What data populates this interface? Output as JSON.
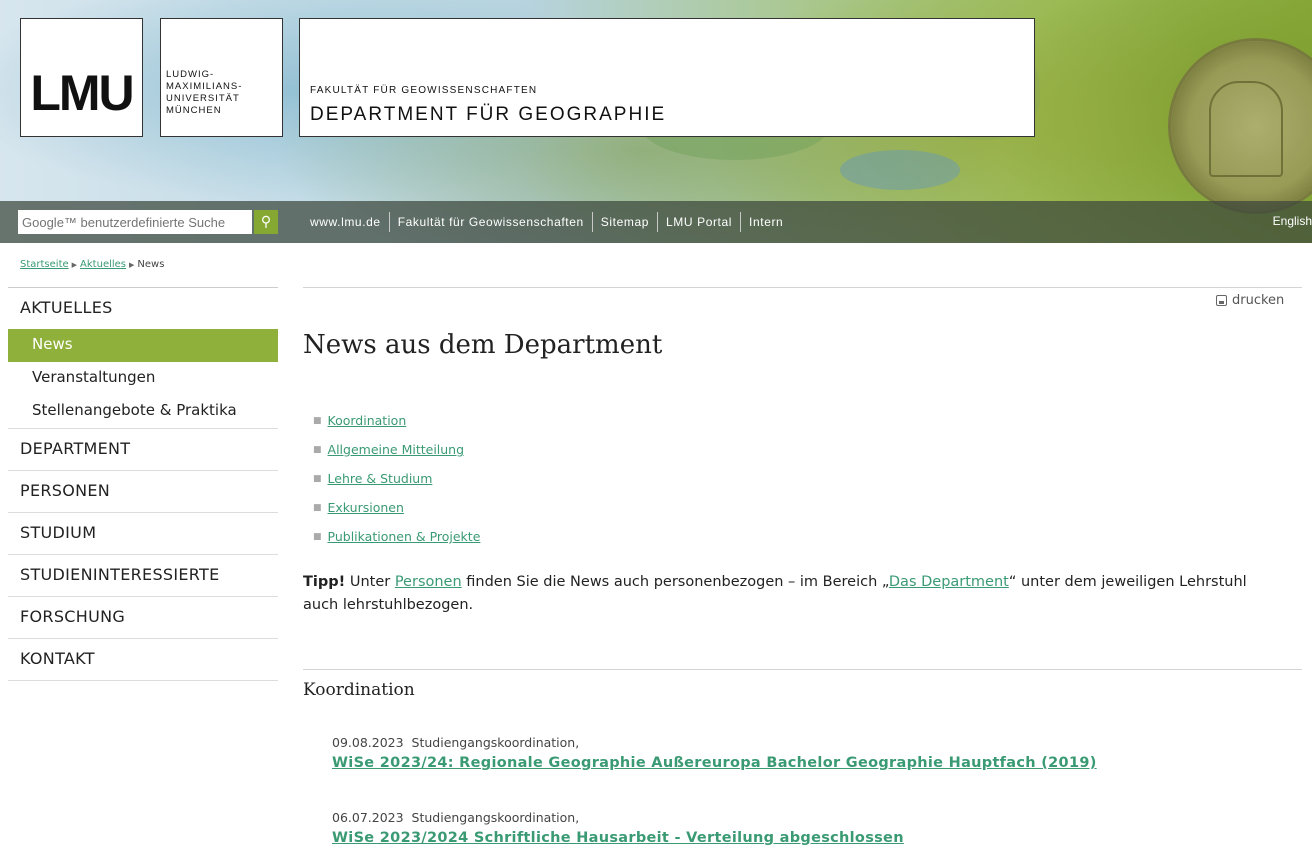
{
  "header": {
    "logo_text": "LMU",
    "university_lines": [
      "LUDWIG-",
      "MAXIMILIANS-",
      "UNIVERSITÄT",
      "MÜNCHEN"
    ],
    "faculty": "FAKULTÄT FÜR GEOWISSENSCHAFTEN",
    "department": "DEPARTMENT FÜR GEOGRAPHIE"
  },
  "search": {
    "placeholder": "Google™ benutzerdefinierte Suche",
    "icon": "search-icon"
  },
  "topnav": {
    "links": [
      "www.lmu.de",
      "Fakultät für Geowissenschaften",
      "Sitemap",
      "LMU Portal",
      "Intern"
    ],
    "language": "English"
  },
  "breadcrumb": [
    "Startseite",
    "Aktuelles",
    "News"
  ],
  "sidebar": {
    "sections": [
      {
        "label": "AKTUELLES",
        "items": [
          {
            "label": "News",
            "active": true
          },
          {
            "label": "Veranstaltungen"
          },
          {
            "label": "Stellenangebote & Praktika"
          }
        ]
      },
      {
        "label": "DEPARTMENT"
      },
      {
        "label": "PERSONEN"
      },
      {
        "label": "STUDIUM"
      },
      {
        "label": "STUDIENINTERESSIERTE"
      },
      {
        "label": "FORSCHUNG"
      },
      {
        "label": "KONTAKT"
      }
    ]
  },
  "main": {
    "print_label": "drucken",
    "title": "News aus dem Department",
    "categories": [
      "Koordination",
      "Allgemeine Mitteilung",
      "Lehre & Studium",
      "Exkursionen",
      "Publikationen & Projekte"
    ],
    "tip": {
      "bold": "Tipp!",
      "t1": " Unter ",
      "link1": "Personen",
      "t2": " finden Sie die News auch personenbezogen – im Bereich „",
      "link2": "Das Department",
      "t3": "“ unter dem jeweiligen Lehrstuhl auch lehrstuhlbezogen."
    },
    "section_title": "Koordination",
    "news": [
      {
        "date": "09.08.2023",
        "source": "Studiengangskoordination,",
        "title": "WiSe 2023/24: Regionale Geographie Außereuropa Bachelor Geographie Hauptfach (2019)"
      },
      {
        "date": "06.07.2023",
        "source": "Studiengangskoordination,",
        "title": "WiSe 2023/2024 Schriftliche Hausarbeit - Verteilung abgeschlossen"
      }
    ]
  }
}
